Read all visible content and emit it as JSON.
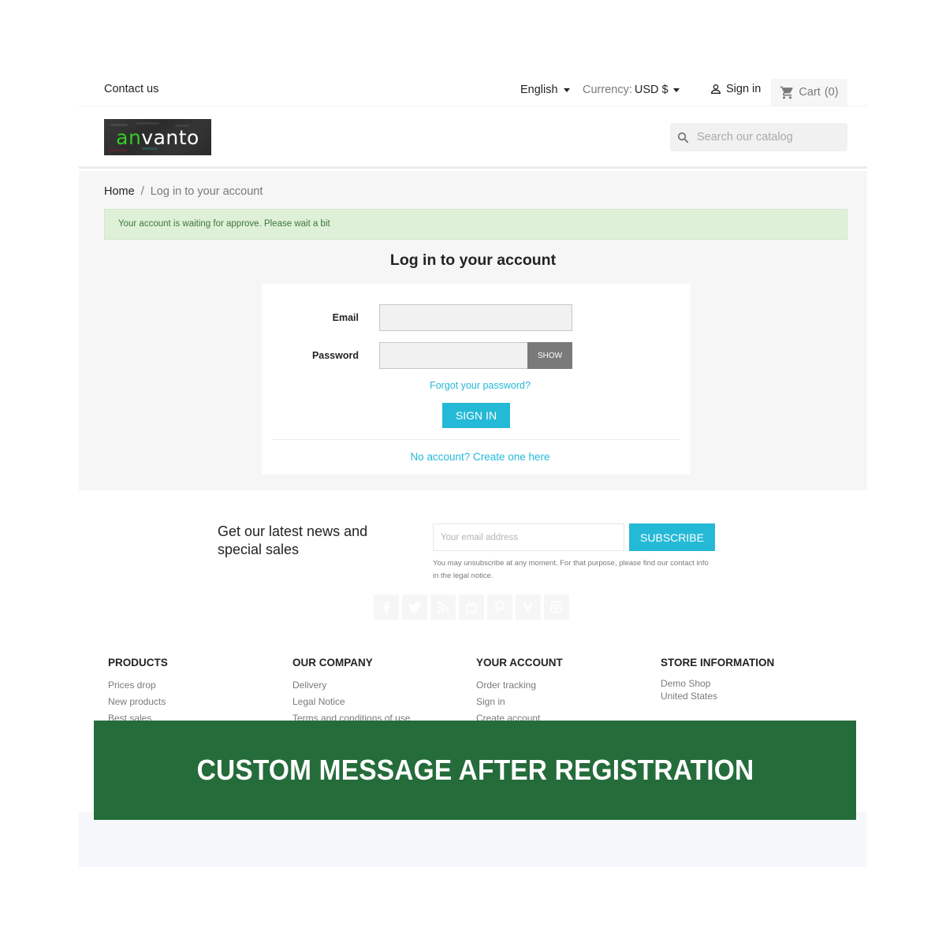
{
  "header": {
    "contact_label": "Contact us",
    "language": "English",
    "currency_label": "Currency:",
    "currency_value": "USD $",
    "signin_label": "Sign in",
    "cart_label": "Cart",
    "cart_count": "(0)",
    "logo_part1": "an",
    "logo_part2": "vanto",
    "search_placeholder": "Search our catalog"
  },
  "breadcrumb": {
    "home": "Home",
    "separator": "/",
    "current": "Log in to your account"
  },
  "alert": {
    "message": "Your account is waiting for approve. Please wait a bit",
    "color": "#dff0d8"
  },
  "login": {
    "title": "Log in to your account",
    "email_label": "Email",
    "email_value": "",
    "password_label": "Password",
    "password_value": "",
    "show_label": "SHOW",
    "forgot_label": "Forgot your password?",
    "signin_button": "SIGN IN",
    "create_account_label": "No account? Create one here"
  },
  "newsletter": {
    "title": "Get our latest news and special sales",
    "email_placeholder": "Your email address",
    "subscribe_label": "SUBSCRIBE",
    "note": "You may unsubscribe at any moment. For that purpose, please find our contact info in the legal notice."
  },
  "social": [
    "facebook",
    "twitter",
    "rss",
    "youtube",
    "pinterest",
    "vimeo",
    "instagram"
  ],
  "footer": {
    "products": {
      "heading": "PRODUCTS",
      "links": [
        "Prices drop",
        "New products",
        "Best sales"
      ]
    },
    "company": {
      "heading": "OUR COMPANY",
      "links": [
        "Delivery",
        "Legal Notice",
        "Terms and conditions of use"
      ]
    },
    "account": {
      "heading": "YOUR ACCOUNT",
      "links": [
        "Order tracking",
        "Sign in",
        "Create account"
      ]
    },
    "store": {
      "heading": "STORE INFORMATION",
      "lines": [
        "Demo Shop",
        "United States"
      ]
    }
  },
  "banner": {
    "text": "CUSTOM MESSAGE AFTER REGISTRATION",
    "color": "#256c3b"
  },
  "colors": {
    "accent": "#24b9d7",
    "text": "#232323",
    "muted": "#7a7a7a"
  }
}
